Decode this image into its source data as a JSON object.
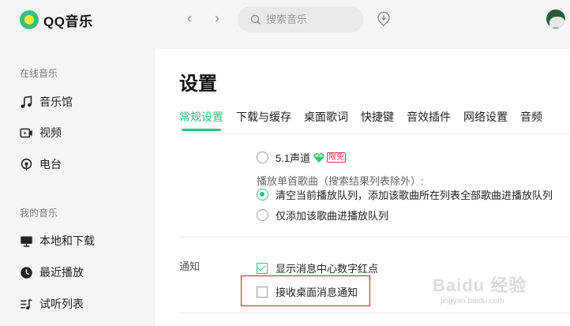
{
  "app": {
    "logo_text": "QQ音乐"
  },
  "sidebar": {
    "online_title": "在线音乐",
    "online_items": [
      {
        "label": "音乐馆",
        "icon": "music-note-icon"
      },
      {
        "label": "视频",
        "icon": "video-icon"
      },
      {
        "label": "电台",
        "icon": "radio-icon"
      }
    ],
    "my_title": "我的音乐",
    "my_items": [
      {
        "label": "本地和下载",
        "icon": "computer-icon"
      },
      {
        "label": "最近播放",
        "icon": "clock-icon"
      },
      {
        "label": "试听列表",
        "icon": "playlist-icon"
      }
    ]
  },
  "topbar": {
    "back_glyph": "‹",
    "forward_glyph": "›",
    "search_placeholder": "搜索音乐"
  },
  "settings": {
    "title": "设置",
    "tabs": [
      {
        "label": "常规设置",
        "active": true
      },
      {
        "label": "下载与缓存",
        "active": false
      },
      {
        "label": "桌面歌词",
        "active": false
      },
      {
        "label": "快捷键",
        "active": false
      },
      {
        "label": "音效插件",
        "active": false
      },
      {
        "label": "网络设置",
        "active": false
      },
      {
        "label": "音频",
        "active": false
      }
    ],
    "surround_option": {
      "label": "5.1声道",
      "badge": "限免",
      "checked": false
    },
    "play_single_label": "播放单首歌曲（搜索结果列表除外）:",
    "play_options": [
      {
        "label": "清空当前播放队列，添加该歌曲所在列表全部歌曲进播放队列",
        "checked": true
      },
      {
        "label": "仅添加该歌曲进播放队列",
        "checked": false
      }
    ],
    "notify_label": "通知",
    "notify_options": [
      {
        "label": "显示消息中心数字红点",
        "checked": true
      },
      {
        "label": "接收桌面消息通知",
        "checked": false
      }
    ]
  },
  "watermark": {
    "main": "Baidu 经验",
    "sub": "jingyan.baidu.com"
  },
  "colors": {
    "accent": "#31c27c",
    "badge_red": "#e8344e",
    "highlight_red": "#d91c1c",
    "sidebar_bg": "#f5f5f5"
  }
}
